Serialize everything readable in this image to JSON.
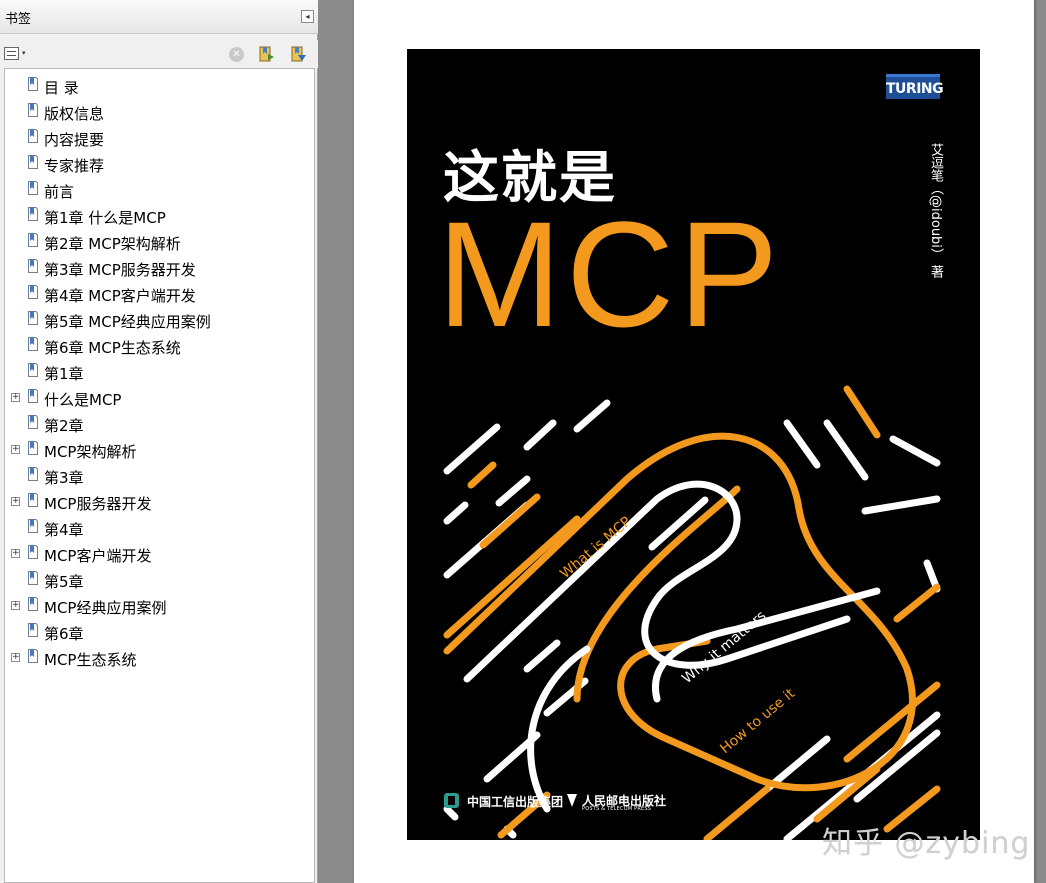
{
  "panel": {
    "title": "书签",
    "collapse_glyph": "◂",
    "options_glyph": "▾",
    "delete_glyph": "✕",
    "items": [
      {
        "label": "目 录",
        "expandable": false
      },
      {
        "label": "版权信息",
        "expandable": false
      },
      {
        "label": "内容提要",
        "expandable": false
      },
      {
        "label": "专家推荐",
        "expandable": false
      },
      {
        "label": "前言",
        "expandable": false
      },
      {
        "label": "第1章 什么是MCP",
        "expandable": false
      },
      {
        "label": "第2章 MCP架构解析",
        "expandable": false
      },
      {
        "label": "第3章 MCP服务器开发",
        "expandable": false
      },
      {
        "label": "第4章 MCP客户端开发",
        "expandable": false
      },
      {
        "label": "第5章 MCP经典应用案例",
        "expandable": false
      },
      {
        "label": "第6章 MCP生态系统",
        "expandable": false
      },
      {
        "label": "第1章",
        "expandable": false
      },
      {
        "label": "什么是MCP",
        "expandable": true
      },
      {
        "label": "第2章",
        "expandable": false
      },
      {
        "label": "MCP架构解析",
        "expandable": true
      },
      {
        "label": "第3章",
        "expandable": false
      },
      {
        "label": "MCP服务器开发",
        "expandable": true
      },
      {
        "label": "第4章",
        "expandable": false
      },
      {
        "label": "MCP客户端开发",
        "expandable": true
      },
      {
        "label": "第5章",
        "expandable": false
      },
      {
        "label": "MCP经典应用案例",
        "expandable": true
      },
      {
        "label": "第6章",
        "expandable": false
      },
      {
        "label": "MCP生态系统",
        "expandable": true
      }
    ],
    "expander_glyph": "+"
  },
  "cover": {
    "badge": "TURING",
    "title_cn": "这就是",
    "title_en": "MCP",
    "author": "艾逗笔（@idoubi） 著",
    "phrases": [
      "What is MCP",
      "Why it matters",
      "How to use it"
    ],
    "publisher1": "中国工信出版集团",
    "publisher2": "人民邮电出版社",
    "publisher2_sub": "POSTS & TELECOM PRESS"
  },
  "watermark": "知乎 @zybing",
  "colors": {
    "accent_orange": "#f39a1e",
    "cover_bg": "#000000",
    "panel_bg": "#f0f0f0",
    "doc_bg": "#8b8b8b"
  },
  "icons": {
    "bookmark": "bookmark-icon",
    "new_bookmark": "new-bookmark-icon",
    "expand_bookmark": "expand-bookmark-icon",
    "delete": "delete-icon",
    "options": "options-menu-icon",
    "collapse": "collapse-panel-icon"
  }
}
